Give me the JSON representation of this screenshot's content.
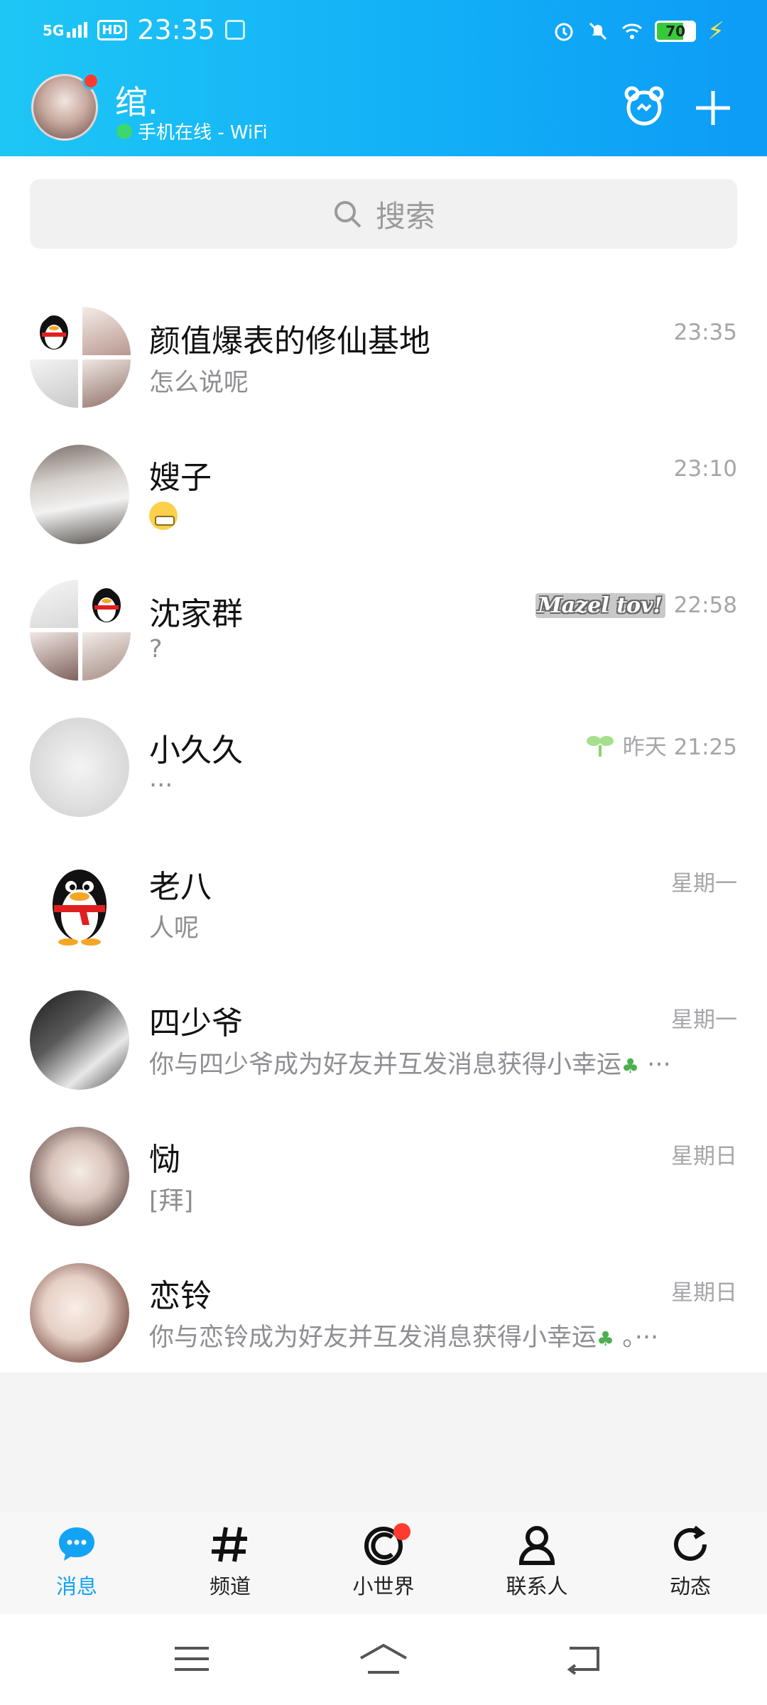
{
  "status_bar": {
    "network": "5G",
    "hd": "HD",
    "time": "23:35",
    "battery": "70",
    "battery_level": 0.7
  },
  "header": {
    "user_name": "绾.",
    "online_status": "手机在线 - WiFi",
    "icons": [
      "pet-icon",
      "plus-icon"
    ],
    "accent_color": "#12b0f7"
  },
  "search": {
    "placeholder": "搜索"
  },
  "conversations": [
    {
      "name": "颜值爆表的修仙基地",
      "preview": "怎么说呢",
      "time": "23:35",
      "avatar": "group"
    },
    {
      "name": "嫂子",
      "preview": "",
      "preview_emoji": "grin-emoji",
      "time": "23:10",
      "avatar": "photo"
    },
    {
      "name": "沈家群",
      "preview": "?",
      "time": "22:58",
      "badge": "Mazel tov!",
      "avatar": "group"
    },
    {
      "name": "小久久",
      "preview": "···",
      "time": "昨天  21:25",
      "avatar": "sketch",
      "sprout": true
    },
    {
      "name": "老八",
      "preview": "人呢",
      "time": "星期一",
      "avatar": "penguin"
    },
    {
      "name": "四少爷",
      "preview": "你与四少爷成为好友并互发消息获得小幸运",
      "preview_suffix": "···",
      "time": "星期一",
      "avatar": "manga"
    },
    {
      "name": "恸",
      "preview": "[拜]",
      "time": "星期日",
      "avatar": "photo"
    },
    {
      "name": "恋铃",
      "preview": "你与恋铃成为好友并互发消息获得小幸运",
      "preview_suffix": "。···",
      "time": "星期日",
      "avatar": "photo"
    }
  ],
  "bottom_nav": [
    {
      "label": "消息",
      "icon": "message-icon",
      "active": true
    },
    {
      "label": "频道",
      "icon": "hash-icon"
    },
    {
      "label": "小世界",
      "icon": "world-icon",
      "has_dot": true
    },
    {
      "label": "联系人",
      "icon": "contacts-icon"
    },
    {
      "label": "动态",
      "icon": "refresh-icon"
    }
  ],
  "system_nav": [
    "menu-icon",
    "home-icon",
    "back-icon"
  ]
}
